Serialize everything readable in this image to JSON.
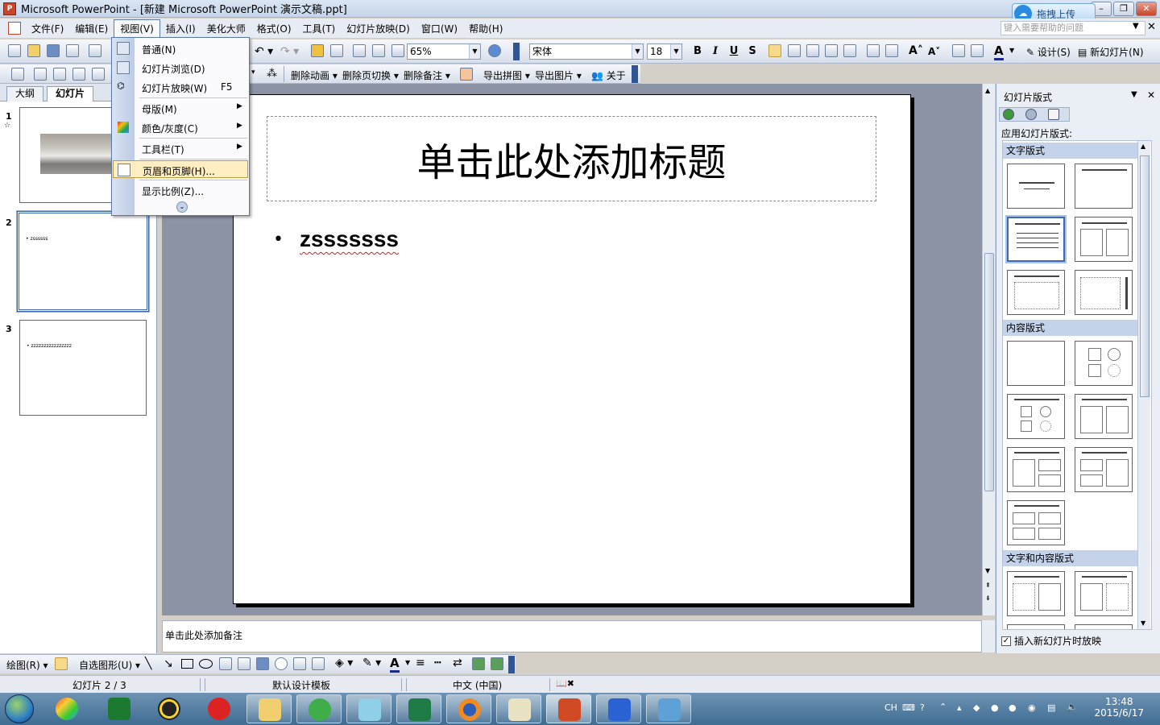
{
  "window": {
    "title": "Microsoft PowerPoint - [新建 Microsoft PowerPoint 演示文稿.ppt]",
    "upload_label": "拖拽上传",
    "win_min": "–",
    "win_max": "□",
    "win_restore": "❐",
    "win_close": "✕"
  },
  "menubar": {
    "items": [
      "文件(F)",
      "编辑(E)",
      "视图(V)",
      "插入(I)",
      "美化大师",
      "格式(O)",
      "工具(T)",
      "幻灯片放映(D)",
      "窗口(W)",
      "帮助(H)"
    ],
    "help_placeholder": "键入需要帮助的问题"
  },
  "toolbar": {
    "zoom": "65%",
    "font": "宋体",
    "font_size": "18",
    "bold": "B",
    "italic": "I",
    "underline": "U",
    "shadow": "S",
    "design_label": "设计(S)",
    "new_slide_label": "新幻灯片(N)",
    "delete_animation": "删除动画",
    "delete_transition": "删除页切换",
    "delete_notes": "删除备注",
    "export_collage": "导出拼图",
    "export_images": "导出图片",
    "about": "关于"
  },
  "view_menu": {
    "items": [
      {
        "label": "普通(N)",
        "accel": "",
        "submenu": false
      },
      {
        "label": "幻灯片浏览(D)",
        "accel": "",
        "submenu": false
      },
      {
        "label": "幻灯片放映(W)",
        "accel": "F5",
        "submenu": false
      },
      {
        "label": "母版(M)",
        "accel": "",
        "submenu": true
      },
      {
        "label": "颜色/灰度(C)",
        "accel": "",
        "submenu": true
      },
      {
        "label": "工具栏(T)",
        "accel": "",
        "submenu": true
      },
      {
        "label": "页眉和页脚(H)...",
        "accel": "",
        "submenu": false
      },
      {
        "label": "显示比例(Z)...",
        "accel": "",
        "submenu": false
      }
    ],
    "highlighted_index": 6
  },
  "left_pane": {
    "tabs": [
      "大纲",
      "幻灯片"
    ],
    "active_tab": "幻灯片",
    "thumbnails": [
      {
        "number": "1",
        "text": ""
      },
      {
        "number": "2",
        "text": "• zssssss"
      },
      {
        "number": "3",
        "text": "• zzzzzzzzzzzzzzzz"
      }
    ],
    "selected_index": 1
  },
  "slide": {
    "title": "单击此处添加标题",
    "bullet": "zsssssss",
    "bullet_glyph": "•"
  },
  "notes": {
    "placeholder": "单击此处添加备注"
  },
  "task_pane": {
    "title": "幻灯片版式",
    "subtitle": "应用幻灯片版式:",
    "sections": [
      "文字版式",
      "内容版式",
      "文字和内容版式"
    ],
    "checkbox_label": "插入新幻灯片时放映",
    "checkbox_checked": true
  },
  "draw_toolbar": {
    "draw_label": "绘图(R)",
    "autoshapes_label": "自选图形(U)"
  },
  "status": {
    "slide_info": "幻灯片 2 / 3",
    "template": "默认设计模板",
    "language": "中文 (中国)"
  },
  "taskbar": {
    "lang": "CH",
    "time": "13:48",
    "date": "2015/6/17"
  },
  "colors": {
    "accent": "#3a64a7",
    "canvas_bg": "#8c93a4",
    "menu_highlight": "#ffeec2",
    "spell_error": "#d12020"
  }
}
